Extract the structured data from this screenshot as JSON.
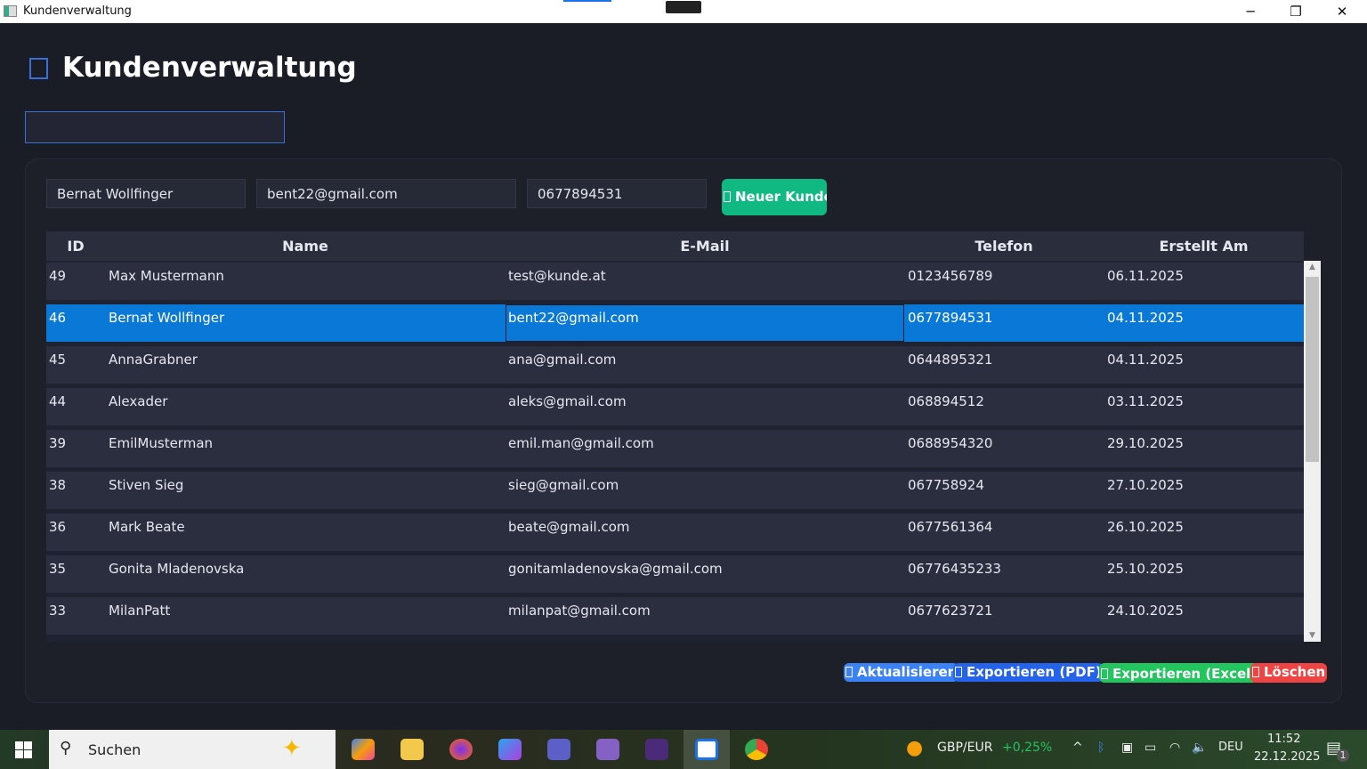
{
  "window": {
    "title": "Kundenverwaltung",
    "minimize": "─",
    "maximize": "❐",
    "close": "✕"
  },
  "header": {
    "title": "Kundenverwaltung",
    "search_value": ""
  },
  "form": {
    "name": "Bernat Wollfinger",
    "email": "bent22@gmail.com",
    "phone": "0677894531",
    "new_button": "Neuer Kunde"
  },
  "table": {
    "columns": [
      "ID",
      "Name",
      "E-Mail",
      "Telefon",
      "Erstellt Am"
    ],
    "rows": [
      [
        "49",
        "Max Mustermann",
        "test@kunde.at",
        "0123456789",
        "06.11.2025"
      ],
      [
        "46",
        "Bernat Wollfinger",
        "bent22@gmail.com",
        "0677894531",
        "04.11.2025"
      ],
      [
        "45",
        "AnnaGrabner",
        "ana@gmail.com",
        "0644895321",
        "04.11.2025"
      ],
      [
        "44",
        "Alexader",
        "aleks@gmail.com",
        "068894512",
        "03.11.2025"
      ],
      [
        "39",
        "EmilMusterman",
        "emil.man@gmail.com",
        "0688954320",
        "29.10.2025"
      ],
      [
        "38",
        "Stiven Sieg",
        "sieg@gmail.com",
        "067758924",
        "27.10.2025"
      ],
      [
        "36",
        "Mark Beate",
        "beate@gmail.com",
        "0677561364",
        "26.10.2025"
      ],
      [
        "35",
        "Gonita Mladenovska",
        "gonitamladenovska@gmail.com",
        "06776435233",
        "25.10.2025"
      ],
      [
        "33",
        "MilanPatt",
        "milanpat@gmail.com",
        "0677623721",
        "24.10.2025"
      ]
    ],
    "selected_index": 1
  },
  "actions": {
    "refresh": "Aktualisieren",
    "pdf": "Exportieren (PDF)",
    "excel": "Exportieren (Excel)",
    "delete": "Löschen"
  },
  "colors": {
    "refresh": "#3b82f6",
    "pdf": "#2563eb",
    "excel": "#22c55e",
    "delete": "#ef4444",
    "new": "#10b981",
    "selection": "#0a78d7"
  },
  "taskbar": {
    "search_placeholder": "Suchen",
    "ticker": "GBP/EUR",
    "ticker_change": "+0,25%",
    "lang": "DEU",
    "time": "11:52",
    "date": "22.12.2025",
    "notifications": "1"
  }
}
